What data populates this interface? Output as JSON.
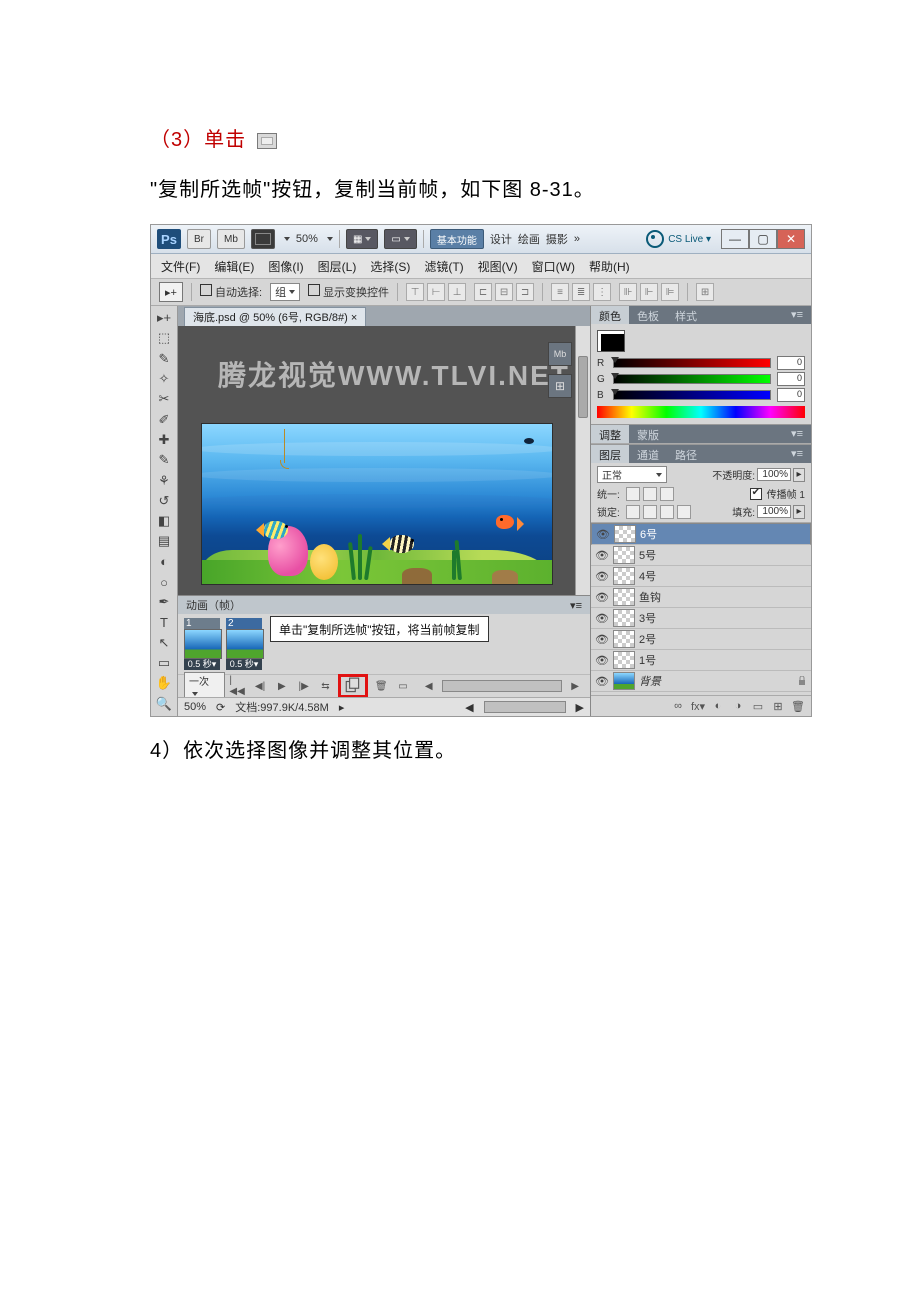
{
  "text": {
    "step3_prefix": "（3）单击",
    "step3_line2": "\"复制所选帧\"按钮，复制当前帧，如下图 8-31。",
    "step4": "4）依次选择图像并调整其位置。"
  },
  "app": {
    "logo": "Ps",
    "br": "Br",
    "mb": "Mb",
    "zoom_label": "50%",
    "workspace_essential": "基本功能",
    "workspace_design": "设计",
    "workspace_paint": "绘画",
    "workspace_photo": "摄影",
    "more": "»",
    "cslive": "CS Live ▾"
  },
  "menu": {
    "file": "文件(F)",
    "edit": "编辑(E)",
    "image": "图像(I)",
    "layer": "图层(L)",
    "select": "选择(S)",
    "filter": "滤镜(T)",
    "view": "视图(V)",
    "window": "窗口(W)",
    "help": "帮助(H)"
  },
  "options": {
    "auto_select": "自动选择:",
    "group": "组",
    "show_transform": "显示变换控件"
  },
  "doc": {
    "tab": "海底.psd @ 50% (6号, RGB/8#)",
    "watermark": "腾龙视觉WWW.TLVI.NET",
    "status_zoom": "50%",
    "status_doc": "文档:997.9K/4.58M"
  },
  "anim": {
    "title": "动画（帧）",
    "frame1_num": "1",
    "frame2_num": "2",
    "frame_time": "0.5 秒▾",
    "tooltip": "单击\"复制所选帧\"按钮，将当前帧复制",
    "loop": "一次"
  },
  "color_panel": {
    "tab_color": "颜色",
    "tab_swatch": "色板",
    "tab_style": "样式",
    "r": "R",
    "g": "G",
    "b": "B",
    "val": "0"
  },
  "adjust_panel": {
    "tab_adjust": "调整",
    "tab_mask": "蒙版"
  },
  "layers": {
    "tab_layer": "图层",
    "tab_channel": "通道",
    "tab_path": "路径",
    "blend": "正常",
    "opacity_label": "不透明度:",
    "opacity_val": "100%",
    "unify_label": "统一:",
    "propagate": "传播帧 1",
    "lock_label": "锁定:",
    "fill_label": "填充:",
    "fill_val": "100%",
    "items": [
      "6号",
      "5号",
      "4号",
      "鱼钩",
      "3号",
      "2号",
      "1号",
      "背景"
    ]
  }
}
